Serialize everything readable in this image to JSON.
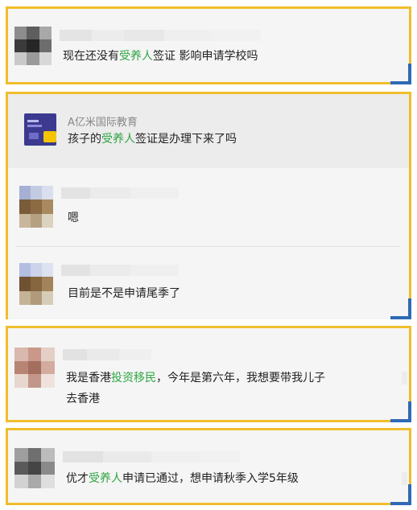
{
  "comments": [
    {
      "segments": [
        {
          "text": "现在还没有",
          "highlight": false
        },
        {
          "text": "受养人",
          "highlight": true
        },
        {
          "text": "签证  影响申请学校吗",
          "highlight": false
        }
      ]
    },
    {
      "quote": {
        "author": "A亿米国际教育",
        "segments": [
          {
            "text": "孩子的",
            "highlight": false
          },
          {
            "text": "受养人",
            "highlight": true
          },
          {
            "text": "签证是办理下来了吗",
            "highlight": false
          }
        ]
      },
      "replies": [
        {
          "text": "嗯"
        },
        {
          "text": "目前是不是申请尾季了"
        }
      ]
    },
    {
      "line1": [
        {
          "text": "我是香港",
          "highlight": false
        },
        {
          "text": "投资移民",
          "highlight": true
        },
        {
          "text": "，今年是第六年，我想要带我儿子",
          "highlight": false
        }
      ],
      "line2": "去香港"
    },
    {
      "segments": [
        {
          "text": "优才",
          "highlight": false
        },
        {
          "text": "受养人",
          "highlight": true
        },
        {
          "text": "申请已通过，想申请秋季入学5年级",
          "highlight": false
        }
      ]
    }
  ],
  "colors": {
    "border": "#f0be2c",
    "corner": "#2f6ab5",
    "highlight": "#2ea443"
  },
  "icons": {
    "brand_logo": "brand-logo-icon"
  }
}
